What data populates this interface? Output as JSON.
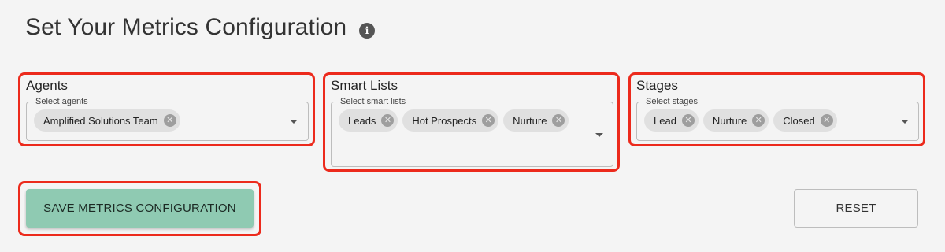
{
  "header": {
    "title": "Set Your Metrics Configuration",
    "info_icon": "i"
  },
  "agents": {
    "title": "Agents",
    "label": "Select agents",
    "chips": [
      "Amplified Solutions Team"
    ]
  },
  "smart_lists": {
    "title": "Smart Lists",
    "label": "Select smart lists",
    "chips": [
      "Leads",
      "Hot Prospects",
      "Nurture"
    ]
  },
  "stages": {
    "title": "Stages",
    "label": "Select stages",
    "chips": [
      "Lead",
      "Nurture",
      "Closed"
    ]
  },
  "actions": {
    "save_label": "SAVE METRICS CONFIGURATION",
    "reset_label": "RESET"
  },
  "icons": {
    "chip_remove": "close-circle-icon",
    "dropdown": "triangle-down-icon",
    "info": "info-icon"
  },
  "colors": {
    "highlight": "#ec2a1c",
    "save_button": "#8fcab2",
    "chip": "#e0e0e0"
  }
}
